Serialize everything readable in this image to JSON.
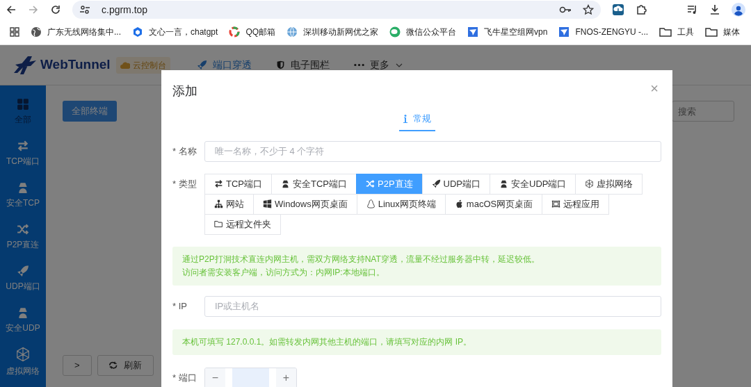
{
  "browser": {
    "url": "c.pgrm.top",
    "bookmarks": [
      {
        "label": "广东无线网络集中..."
      },
      {
        "label": "文心一言，chatgpt"
      },
      {
        "label": "QQ邮箱"
      },
      {
        "label": "深圳移动新网优之家"
      },
      {
        "label": "微信公众平台"
      },
      {
        "label": "飞牛星空组网vpn"
      },
      {
        "label": "FNOS-ZENGYU -..."
      },
      {
        "label": "工具"
      },
      {
        "label": "媒体"
      }
    ]
  },
  "app": {
    "brand": "WebTunnel",
    "console_badge": "云控制台",
    "nav": [
      {
        "label": "端口穿透",
        "selected": true
      },
      {
        "label": "电子围栏",
        "selected": false
      },
      {
        "label": "更多",
        "selected": false
      }
    ],
    "sidebar": {
      "items": [
        {
          "label": "全部",
          "selected": true
        },
        {
          "label": "TCP端口",
          "selected": false
        },
        {
          "label": "安全TCP",
          "selected": false
        },
        {
          "label": "P2P直连",
          "selected": false
        },
        {
          "label": "UDP端口",
          "selected": false
        },
        {
          "label": "安全UDP",
          "selected": false
        },
        {
          "label": "虚拟网络",
          "selected": false
        }
      ]
    },
    "filter_button": "全部终端",
    "search": {
      "placeholder": "搜索"
    },
    "expand_button": ">",
    "refresh_button": "刷新"
  },
  "dialog": {
    "title": "添加",
    "close": "×",
    "tabs": [
      {
        "label": "常规",
        "selected": true
      }
    ],
    "form": [
      {
        "kind": "text",
        "label": "* 名称",
        "placeholder": "唯一名称，不少于 4 个字符"
      },
      {
        "kind": "choice",
        "label": "* 类型",
        "options": [
          {
            "label": "TCP端口",
            "selected": false
          },
          {
            "label": "安全TCP端口",
            "selected": false
          },
          {
            "label": "P2P直连",
            "selected": true
          },
          {
            "label": "UDP端口",
            "selected": false
          },
          {
            "label": "安全UDP端口",
            "selected": false
          },
          {
            "label": "虚拟网络",
            "selected": false
          },
          {
            "label": "网站",
            "selected": false
          },
          {
            "label": "Windows网页桌面",
            "selected": false
          },
          {
            "label": "Linux网页终端",
            "selected": false
          },
          {
            "label": "macOS网页桌面",
            "selected": false
          },
          {
            "label": "远程应用",
            "selected": false
          },
          {
            "label": "远程文件夹",
            "selected": false
          }
        ]
      },
      {
        "kind": "note",
        "lines": [
          "通过P2P打洞技术直连内网主机，需双方网络支持NAT穿透，流量不经过服务器中转，延迟较低。",
          "访问者需安装客户端，访问方式为：内网IP:本地端口。"
        ]
      },
      {
        "kind": "text",
        "label": "* IP",
        "placeholder": "IP或主机名"
      },
      {
        "kind": "note",
        "lines": [
          "本机可填写 127.0.0.1。如需转发内网其他主机的端口，请填写对应的内网 IP。"
        ]
      },
      {
        "kind": "number",
        "label": "* 端口",
        "decrement": "−",
        "increment": "+"
      }
    ]
  }
}
